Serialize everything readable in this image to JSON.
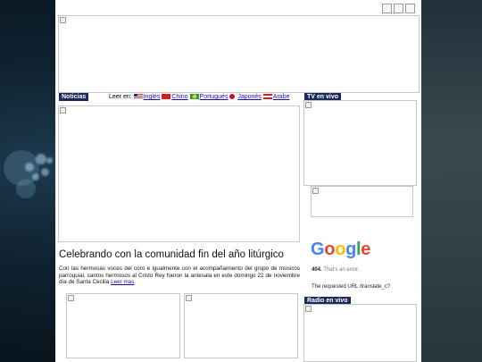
{
  "header": {
    "top_buttons": [
      "image-button",
      "image-button",
      "image-button"
    ]
  },
  "news_bar": {
    "label": "Noticias",
    "read_in": "Leer en:",
    "languages": [
      {
        "label": "Inglés",
        "icon": "us-flag-icon"
      },
      {
        "label": "Chino",
        "icon": "china-flag-icon"
      },
      {
        "label": "Portugués",
        "icon": "brazil-flag-icon"
      },
      {
        "label": "Japonés",
        "icon": "japan-flag-icon"
      },
      {
        "label": "Arabe",
        "icon": "lebanon-flag-icon"
      }
    ]
  },
  "article": {
    "headline": "Celebrando con la comunidad fin del año litúrgico",
    "summary": "Con las hermosas voces del coro e igualmente con el acompañamiento del grupo de músicos parroquial, cantos hermosos al Cristo Rey fueron la antesala en este domingo 22 de noviembre día de Santa Cecilia",
    "read_more": "Leer mas"
  },
  "sidebar": {
    "tv_label": "TV en vivo",
    "radio_label": "Radio en vivo",
    "google_error": {
      "logo": "Google",
      "code": "404.",
      "message": "That's an error.",
      "detail": "The requested URL /translate_c?"
    }
  }
}
